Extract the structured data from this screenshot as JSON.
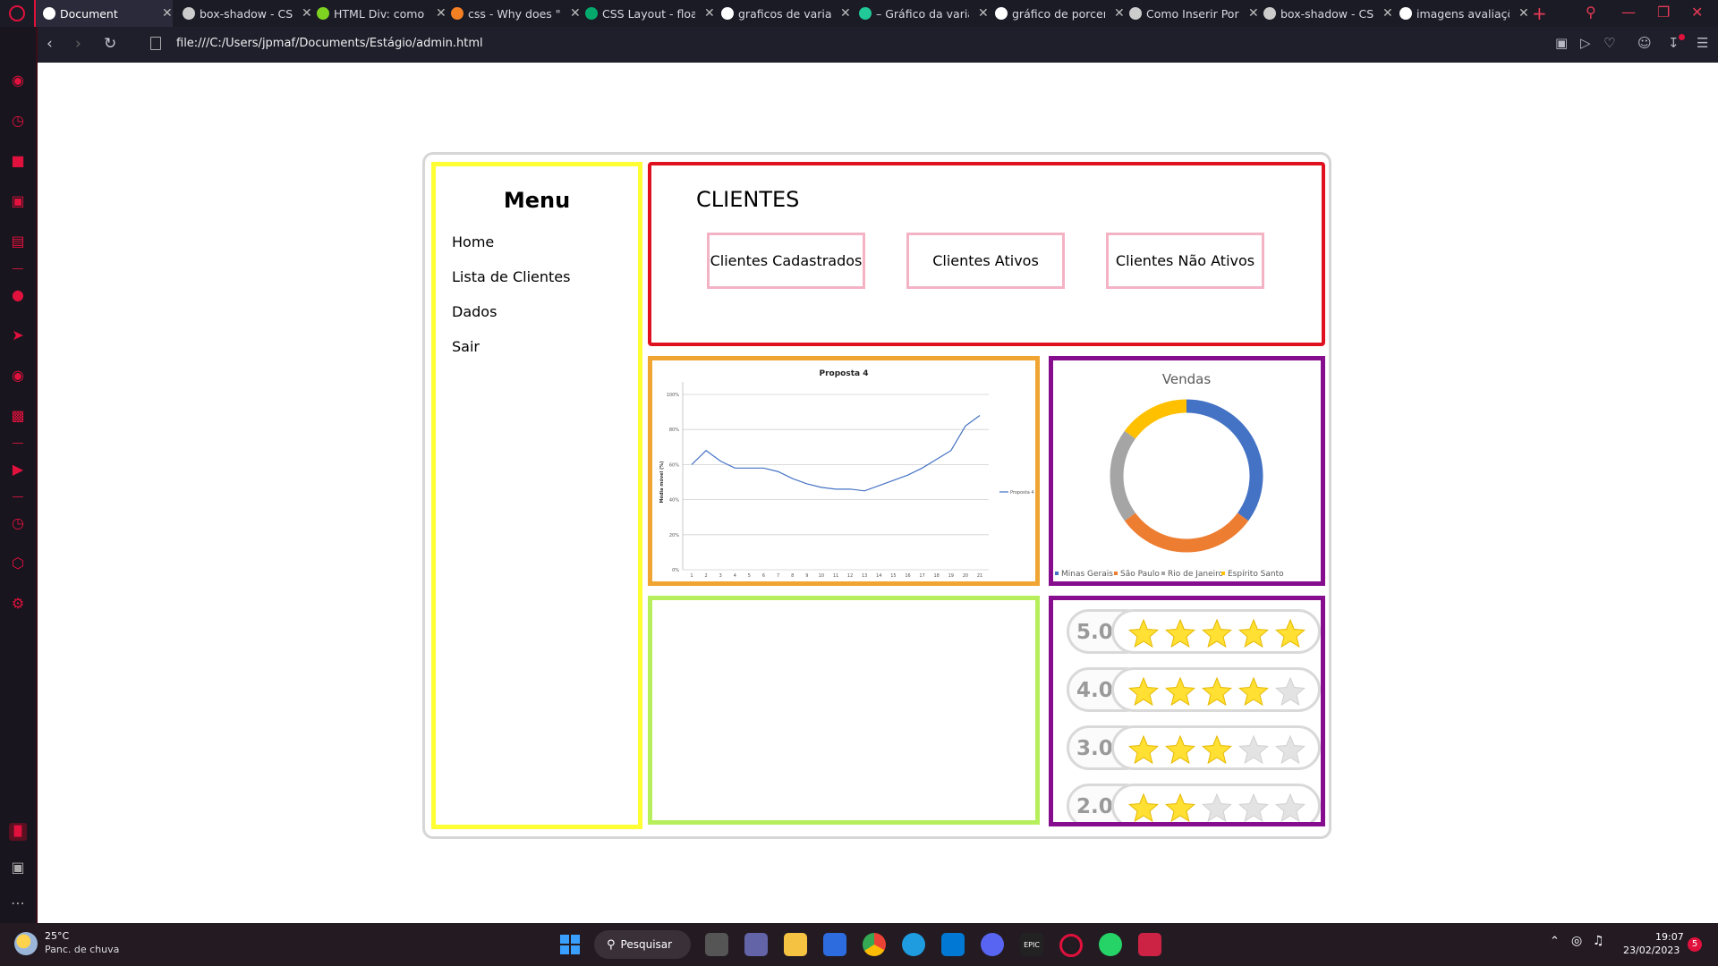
{
  "browser": {
    "tabs": [
      {
        "title": "Document",
        "active": true,
        "icon": "opera-doc-icon",
        "color": "#ffffff"
      },
      {
        "title": "box-shadow - CSS",
        "icon": "mdn-icon",
        "color": "#cccccc"
      },
      {
        "title": "HTML Div: como c",
        "icon": "hostinger-icon",
        "color": "#7ed321"
      },
      {
        "title": "css - Why does \"le",
        "icon": "stackoverflow-icon",
        "color": "#f48024"
      },
      {
        "title": "CSS Layout - float",
        "icon": "w3schools-icon",
        "color": "#04aa6d"
      },
      {
        "title": "graficos de variaç",
        "icon": "google-icon",
        "color": "#ffffff"
      },
      {
        "title": "– Gráfico da variaç",
        "icon": "r-icon",
        "color": "#20c997"
      },
      {
        "title": "gráfico de porcen",
        "icon": "google-icon",
        "color": "#ffffff"
      },
      {
        "title": "Como Inserir Porc",
        "icon": "doc-icon",
        "color": "#cccccc"
      },
      {
        "title": "box-shadow - CSS",
        "icon": "mdn-icon",
        "color": "#cccccc"
      },
      {
        "title": "imagens avaliaçõe",
        "icon": "google-icon",
        "color": "#ffffff"
      }
    ],
    "url": "file:///C:/Users/jpmaf/Documents/Estágio/admin.html"
  },
  "menu": {
    "title": "Menu",
    "items": [
      "Home",
      "Lista de Clientes",
      "Dados",
      "Sair"
    ]
  },
  "clientes": {
    "title": "CLIENTES",
    "boxes": [
      "Clientes Cadastrados",
      "Clientes Ativos",
      "Clientes Não Ativos"
    ]
  },
  "chart_data": [
    {
      "type": "line",
      "title": "Proposta 4",
      "ylabel": "Média móvel (%)",
      "xlabel": "",
      "x": [
        1,
        2,
        3,
        4,
        5,
        6,
        7,
        8,
        9,
        10,
        11,
        12,
        13,
        14,
        15,
        16,
        17,
        18,
        19,
        20,
        21
      ],
      "yticks": [
        "0%",
        "20%",
        "40%",
        "60%",
        "80%",
        "100%"
      ],
      "ylim": [
        0,
        100
      ],
      "series": [
        {
          "name": "Proposta 4",
          "color": "#4472c4",
          "values": [
            60,
            68,
            62,
            58,
            58,
            58,
            56,
            52,
            49,
            47,
            46,
            46,
            45,
            48,
            51,
            54,
            58,
            63,
            68,
            82,
            88
          ]
        }
      ],
      "legend": "right"
    },
    {
      "type": "pie",
      "donut": true,
      "title": "Vendas",
      "labels": [
        "Minas Gerais",
        "São Paulo",
        "Rio de Janeiro",
        "Espírito Santo"
      ],
      "values": [
        35,
        30,
        20,
        15
      ],
      "colors": [
        "#4472c4",
        "#ed7d31",
        "#a5a5a5",
        "#ffc000"
      ],
      "legend": "bottom"
    }
  ],
  "ratings": [
    {
      "score": "5.0",
      "stars": 5
    },
    {
      "score": "4.0",
      "stars": 4
    },
    {
      "score": "3.0",
      "stars": 3
    },
    {
      "score": "2.0",
      "stars": 2
    }
  ],
  "taskbar": {
    "weather_temp": "25°C",
    "weather_desc": "Panc. de chuva",
    "search_label": "Pesquisar",
    "time": "19:07",
    "date": "23/02/2023",
    "notif_count": "5"
  },
  "colors": {
    "menu_border": "#ffff33",
    "clientes_border": "#e0111f",
    "line_border": "#f0a533",
    "donut_border": "#850d8e",
    "green_border": "#b7ef5c",
    "box_border": "#f4b3c5"
  }
}
